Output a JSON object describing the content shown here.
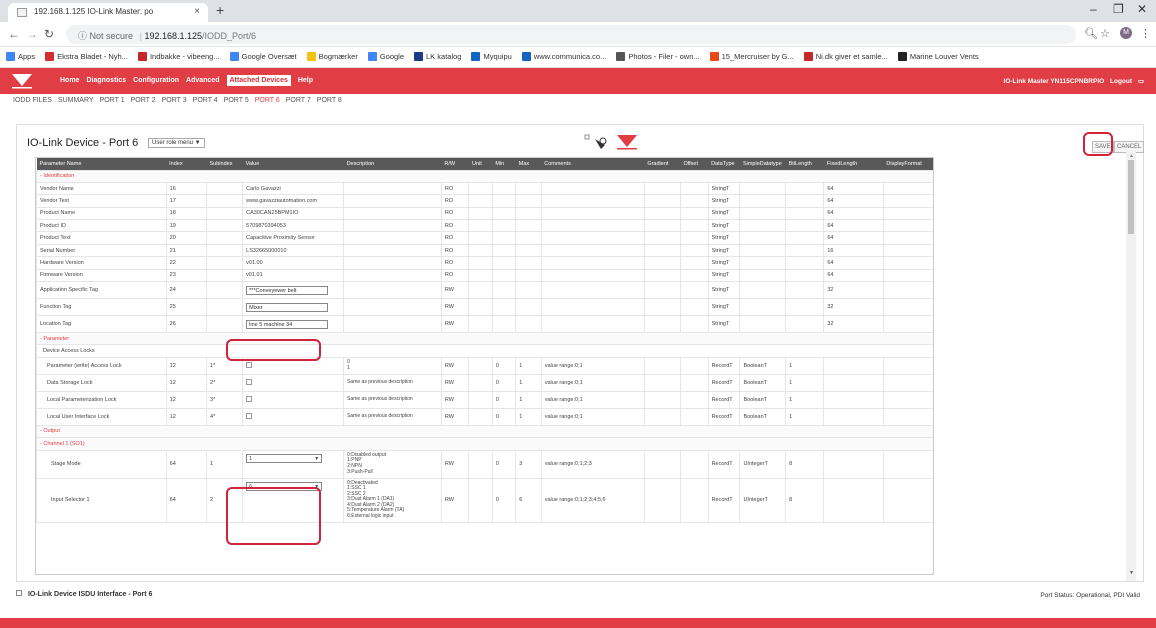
{
  "browser": {
    "tab_title": "192.168.1.125 IO-Link Master: po",
    "tab_close": "×",
    "new_tab": "+",
    "url_host": "192.168.1.125",
    "url_path": "/IODD_Port/6",
    "not_secure": "Not secure",
    "window_controls": [
      "–",
      "❐",
      "✕"
    ],
    "avatar_letter": "M",
    "bookmarks": [
      {
        "label": "Apps",
        "color": "#4285f4"
      },
      {
        "label": "Ekstra Bladet - Nyh...",
        "color": "#d32f2f"
      },
      {
        "label": "Indbakke - vibeeng...",
        "color": "#c62828"
      },
      {
        "label": "Google Oversæt",
        "color": "#4285f4"
      },
      {
        "label": "Bogmærker",
        "color": "#f4c20d"
      },
      {
        "label": "Google",
        "color": "#4285f4"
      },
      {
        "label": "LK katalog",
        "color": "#1e3a8a"
      },
      {
        "label": "Myquipu",
        "color": "#1565c0"
      },
      {
        "label": "www.communica.co...",
        "color": "#1565c0"
      },
      {
        "label": "Photos - Filer - own...",
        "color": "#555555"
      },
      {
        "label": "15_Mercruiser by G...",
        "color": "#e64a19"
      },
      {
        "label": "Ni.dk giver et samle...",
        "color": "#c62828"
      },
      {
        "label": "Marine Louver Vents",
        "color": "#222222"
      }
    ]
  },
  "app": {
    "accent": "#e03d45",
    "nav": [
      "Home",
      "Diagnostics",
      "Configuration",
      "Advanced",
      "Attached Devices",
      "Help"
    ],
    "nav_active": "Attached Devices",
    "master_label": "IO-Link Master YN115CPNBRPIO",
    "logout": "Logout",
    "subnav": [
      "IODD FILES",
      "SUMMARY",
      "PORT 1",
      "PORT 2",
      "PORT 3",
      "PORT 4",
      "PORT 5",
      "PORT 6",
      "PORT 7",
      "PORT 8"
    ],
    "subnav_active": "PORT 6"
  },
  "panel": {
    "title": "IO-Link Device - Port 6",
    "role_menu": "User role menu ▼",
    "save": "SAVE",
    "cancel": "CANCEL",
    "isdu": "IO-Link Device ISDU Interface - Port 6",
    "status": "Port Status: Operational, PDI Valid"
  },
  "table": {
    "headers": [
      "Parameter Name",
      "Index",
      "Subindex",
      "Value",
      "Description",
      "R/W",
      "Unit",
      "Min",
      "Max",
      "Comments",
      "Gradient",
      "Offset",
      "DataType",
      "SimpleDatatype",
      "BitLength",
      "FixedLength",
      "DisplayFormat"
    ],
    "sections": {
      "identification": "- Identification",
      "parameter": "- Parameter",
      "device_access_locks": "Device Access Locks",
      "output": "- Output",
      "channel1": "- Channel 1 (SO1)"
    },
    "identification_rows": [
      {
        "name": "Vendor Name",
        "index": "16",
        "value": "Carlo Gavazzi",
        "rw": "RO",
        "datatype": "StringT",
        "fixed": "64"
      },
      {
        "name": "Vendor Text",
        "index": "17",
        "value": "www.gavazziautomation.com",
        "rw": "RO",
        "datatype": "StringT",
        "fixed": "64"
      },
      {
        "name": "Product Name",
        "index": "18",
        "value": "CA30CAN25BPM1IO",
        "rw": "RO",
        "datatype": "StringT",
        "fixed": "64"
      },
      {
        "name": "Product ID",
        "index": "19",
        "value": "5709870394053",
        "rw": "RO",
        "datatype": "StringT",
        "fixed": "64"
      },
      {
        "name": "Product Text",
        "index": "20",
        "value": "Capacitive Proximity Sensor",
        "rw": "RO",
        "datatype": "StringT",
        "fixed": "64"
      },
      {
        "name": "Serial Number",
        "index": "21",
        "value": "LS32665000010",
        "rw": "RO",
        "datatype": "StringT",
        "fixed": "16"
      },
      {
        "name": "Hardware Version",
        "index": "22",
        "value": "v01.00",
        "rw": "RO",
        "datatype": "StringT",
        "fixed": "64"
      },
      {
        "name": "Firmware Version",
        "index": "23",
        "value": "v01.01",
        "rw": "RO",
        "datatype": "StringT",
        "fixed": "64"
      }
    ],
    "input_rows": [
      {
        "name": "Application Specific Tag",
        "index": "24",
        "value": "***Conveyewer belt",
        "rw": "RW",
        "datatype": "StringT",
        "fixed": "32"
      },
      {
        "name": "Function Tag",
        "index": "25",
        "value": "Mixer",
        "rw": "RW",
        "datatype": "StringT",
        "fixed": "32"
      },
      {
        "name": "Location Tag",
        "index": "26",
        "value": "line 5 machine 34",
        "rw": "RW",
        "datatype": "StringT",
        "fixed": "32"
      }
    ],
    "lock_rows": [
      {
        "name": "Parameter (write) Access Lock",
        "index": "12",
        "sub": "1*",
        "desc": "0\n1",
        "rw": "RW",
        "min": "0",
        "max": "1",
        "comments": "value range:0;1",
        "datatype": "RecordT",
        "simple": "BooleanT",
        "bitlen": "1"
      },
      {
        "name": "Data Storage Lock",
        "index": "12",
        "sub": "2*",
        "desc": "Same as previous description",
        "rw": "RW",
        "min": "0",
        "max": "1",
        "comments": "value range:0;1",
        "datatype": "RecordT",
        "simple": "BooleanT",
        "bitlen": "1"
      },
      {
        "name": "Local Parameterization Lock",
        "index": "12",
        "sub": "3*",
        "desc": "Same as previous description",
        "rw": "RW",
        "min": "0",
        "max": "1",
        "comments": "value range:0;1",
        "datatype": "RecordT",
        "simple": "BooleanT",
        "bitlen": "1"
      },
      {
        "name": "Local User Interface Lock",
        "index": "12",
        "sub": "4*",
        "desc": "Same as previous description",
        "rw": "RW",
        "min": "0",
        "max": "1",
        "comments": "value range:0;1",
        "datatype": "RecordT",
        "simple": "BooleanT",
        "bitlen": "1"
      }
    ],
    "channel_rows": [
      {
        "name": "Stage Mode",
        "index": "64",
        "sub": "1",
        "value": "1",
        "desc": "0:Disabled output\n1:PNP\n2:NPN\n3:Push-Pull",
        "rw": "RW",
        "min": "0",
        "max": "3",
        "comments": "value range:0;1;2;3",
        "datatype": "RecordT",
        "simple": "UIntegerT",
        "bitlen": "8"
      },
      {
        "name": "Input Selector 1",
        "index": "64",
        "sub": "2",
        "value": "6",
        "desc": "0:Deactivated\n1:SSC 1\n2:SSC 2\n3:Dust Alarm 1 (DA1)\n4:Dust Alarm 2 (DA2)\n5:Temperature Alarm (TA)\n6:External logic input",
        "rw": "RW",
        "min": "0",
        "max": "6",
        "comments": "value range:0;1;2;3;4;5;6",
        "datatype": "RecordT",
        "simple": "UIntegerT",
        "bitlen": "8"
      }
    ]
  }
}
